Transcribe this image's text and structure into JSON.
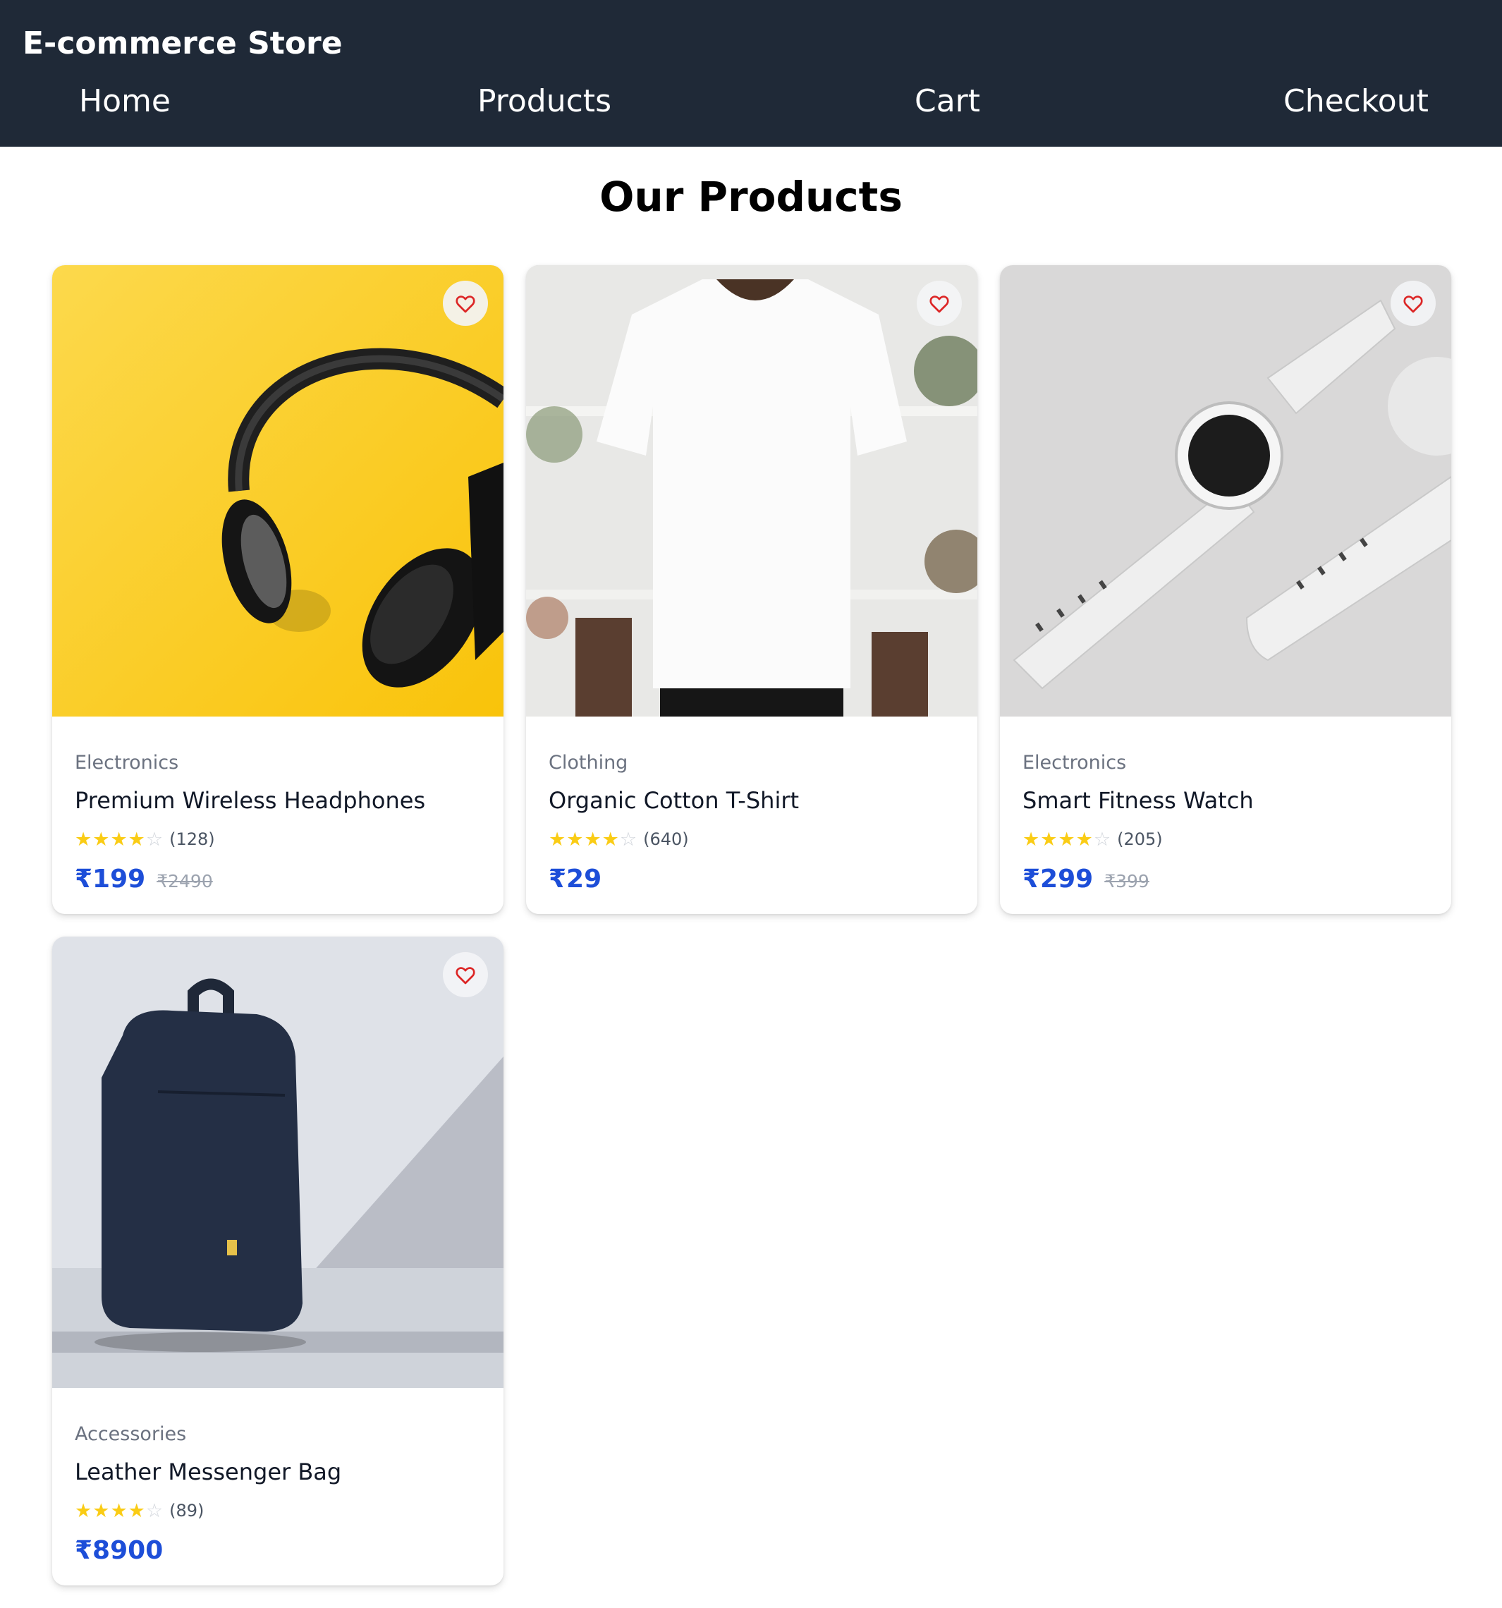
{
  "header": {
    "brand": "E-commerce Store",
    "nav": [
      "Home",
      "Products",
      "Cart",
      "Checkout"
    ]
  },
  "main": {
    "title": "Our Products",
    "products": [
      {
        "category": "Electronics",
        "name": "Premium Wireless Headphones",
        "rating_stars": 4,
        "reviews": "(128)",
        "price": "₹199",
        "old_price": "₹2490",
        "image": "headphones-image"
      },
      {
        "category": "Clothing",
        "name": "Organic Cotton T-Shirt",
        "rating_stars": 4,
        "reviews": "(640)",
        "price": "₹29",
        "old_price": "",
        "image": "tshirt-image"
      },
      {
        "category": "Electronics",
        "name": "Smart Fitness Watch",
        "rating_stars": 4,
        "reviews": "(205)",
        "price": "₹299",
        "old_price": "₹399",
        "image": "watch-image"
      },
      {
        "category": "Accessories",
        "name": "Leather Messenger Bag",
        "rating_stars": 4,
        "reviews": "(89)",
        "price": "₹8900",
        "old_price": "",
        "image": "backpack-image"
      }
    ]
  },
  "colors": {
    "navbar": "#1f2937",
    "price": "#1d4ed8",
    "star": "#facc15",
    "heart": "#dc2626"
  },
  "icons": {
    "favorite": "heart-icon",
    "rating": "star-icon"
  }
}
